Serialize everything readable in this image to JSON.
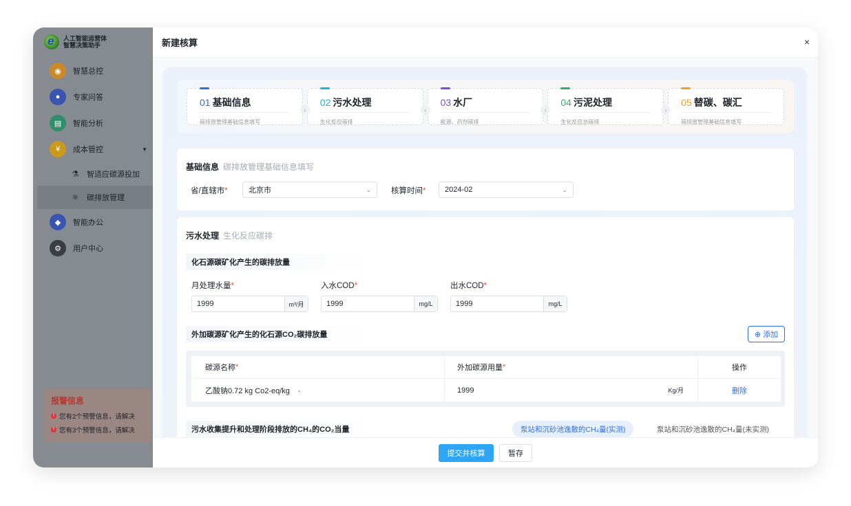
{
  "logo": {
    "line1": "人工智能运营体",
    "line2": "智慧决策助手"
  },
  "nav": {
    "items": [
      {
        "label": "智慧总控",
        "color": "#c98a2a"
      },
      {
        "label": "专家问答",
        "color": "#3a55b0"
      },
      {
        "label": "智能分析",
        "color": "#2e8f6a"
      },
      {
        "label": "成本管控",
        "color": "#c99a1e"
      }
    ],
    "subs": [
      {
        "label": "智适应碳源投加"
      },
      {
        "label": "碳排放管理"
      }
    ],
    "items2": [
      {
        "label": "智能办公",
        "color": "#3a55b0"
      },
      {
        "label": "用户中心",
        "color": "#3a3d42"
      }
    ]
  },
  "alert": {
    "title": "报警信息",
    "rows": [
      "您有2个预警信息，请解决",
      "您有3个预警信息，请解决"
    ]
  },
  "dialog": {
    "title": "新建核算",
    "close": "×"
  },
  "steps": [
    {
      "num": "01",
      "title": "基础信息",
      "desc": "碳排放管理基础信息填写",
      "color": "#2f6fe0"
    },
    {
      "num": "02",
      "title": "污水处理",
      "desc": "生化反应碳排",
      "color": "#1fb4d6"
    },
    {
      "num": "03",
      "title": "水厂",
      "desc": "能源、药剂碳排",
      "color": "#7a4ce0"
    },
    {
      "num": "04",
      "title": "污泥处理",
      "desc": "生化反应总碳排",
      "color": "#2fb06b"
    },
    {
      "num": "05",
      "title": "替碳、碳汇",
      "desc": "碳排放管理基础信息填写",
      "color": "#f0a024"
    }
  ],
  "basic": {
    "title": "基础信息",
    "sub": "碳排放管理基础信息填写",
    "province_label": "省/直辖市",
    "province_value": "北京市",
    "time_label": "核算时间",
    "time_value": "2024-02"
  },
  "sewage": {
    "title": "污水处理",
    "sub": "生化反应碳排",
    "fossil_head": "化石源碳矿化产生的碳排放量",
    "fields": [
      {
        "label": "月处理水量",
        "value": "1999",
        "unit": "m³/月"
      },
      {
        "label": "入水COD",
        "value": "1999",
        "unit": "mg/L"
      },
      {
        "label": "出水COD",
        "value": "1999",
        "unit": "mg/L"
      }
    ],
    "external_head": "外加碳源矿化产生的化石源CO₂碳排放量",
    "add_label": "添加",
    "table": {
      "headers": [
        "碳源名称",
        "外加碳源用量",
        "操作"
      ],
      "row": {
        "name": "乙酸钠0.72 kg Co2-eq/kg",
        "amount": "1999",
        "unit": "Kg/月",
        "action": "删除"
      }
    },
    "ch4_head": "污水收集提升和处理阶段排放的CH₄的CO₂当量",
    "tab_active": "泵站和沉砂池逸散的CH₄量(实测)",
    "tab_inactive": "泵站和沉砂池逸散的CH₄量(未实测)"
  },
  "footer": {
    "submit": "提交并核算",
    "save": "暂存"
  }
}
